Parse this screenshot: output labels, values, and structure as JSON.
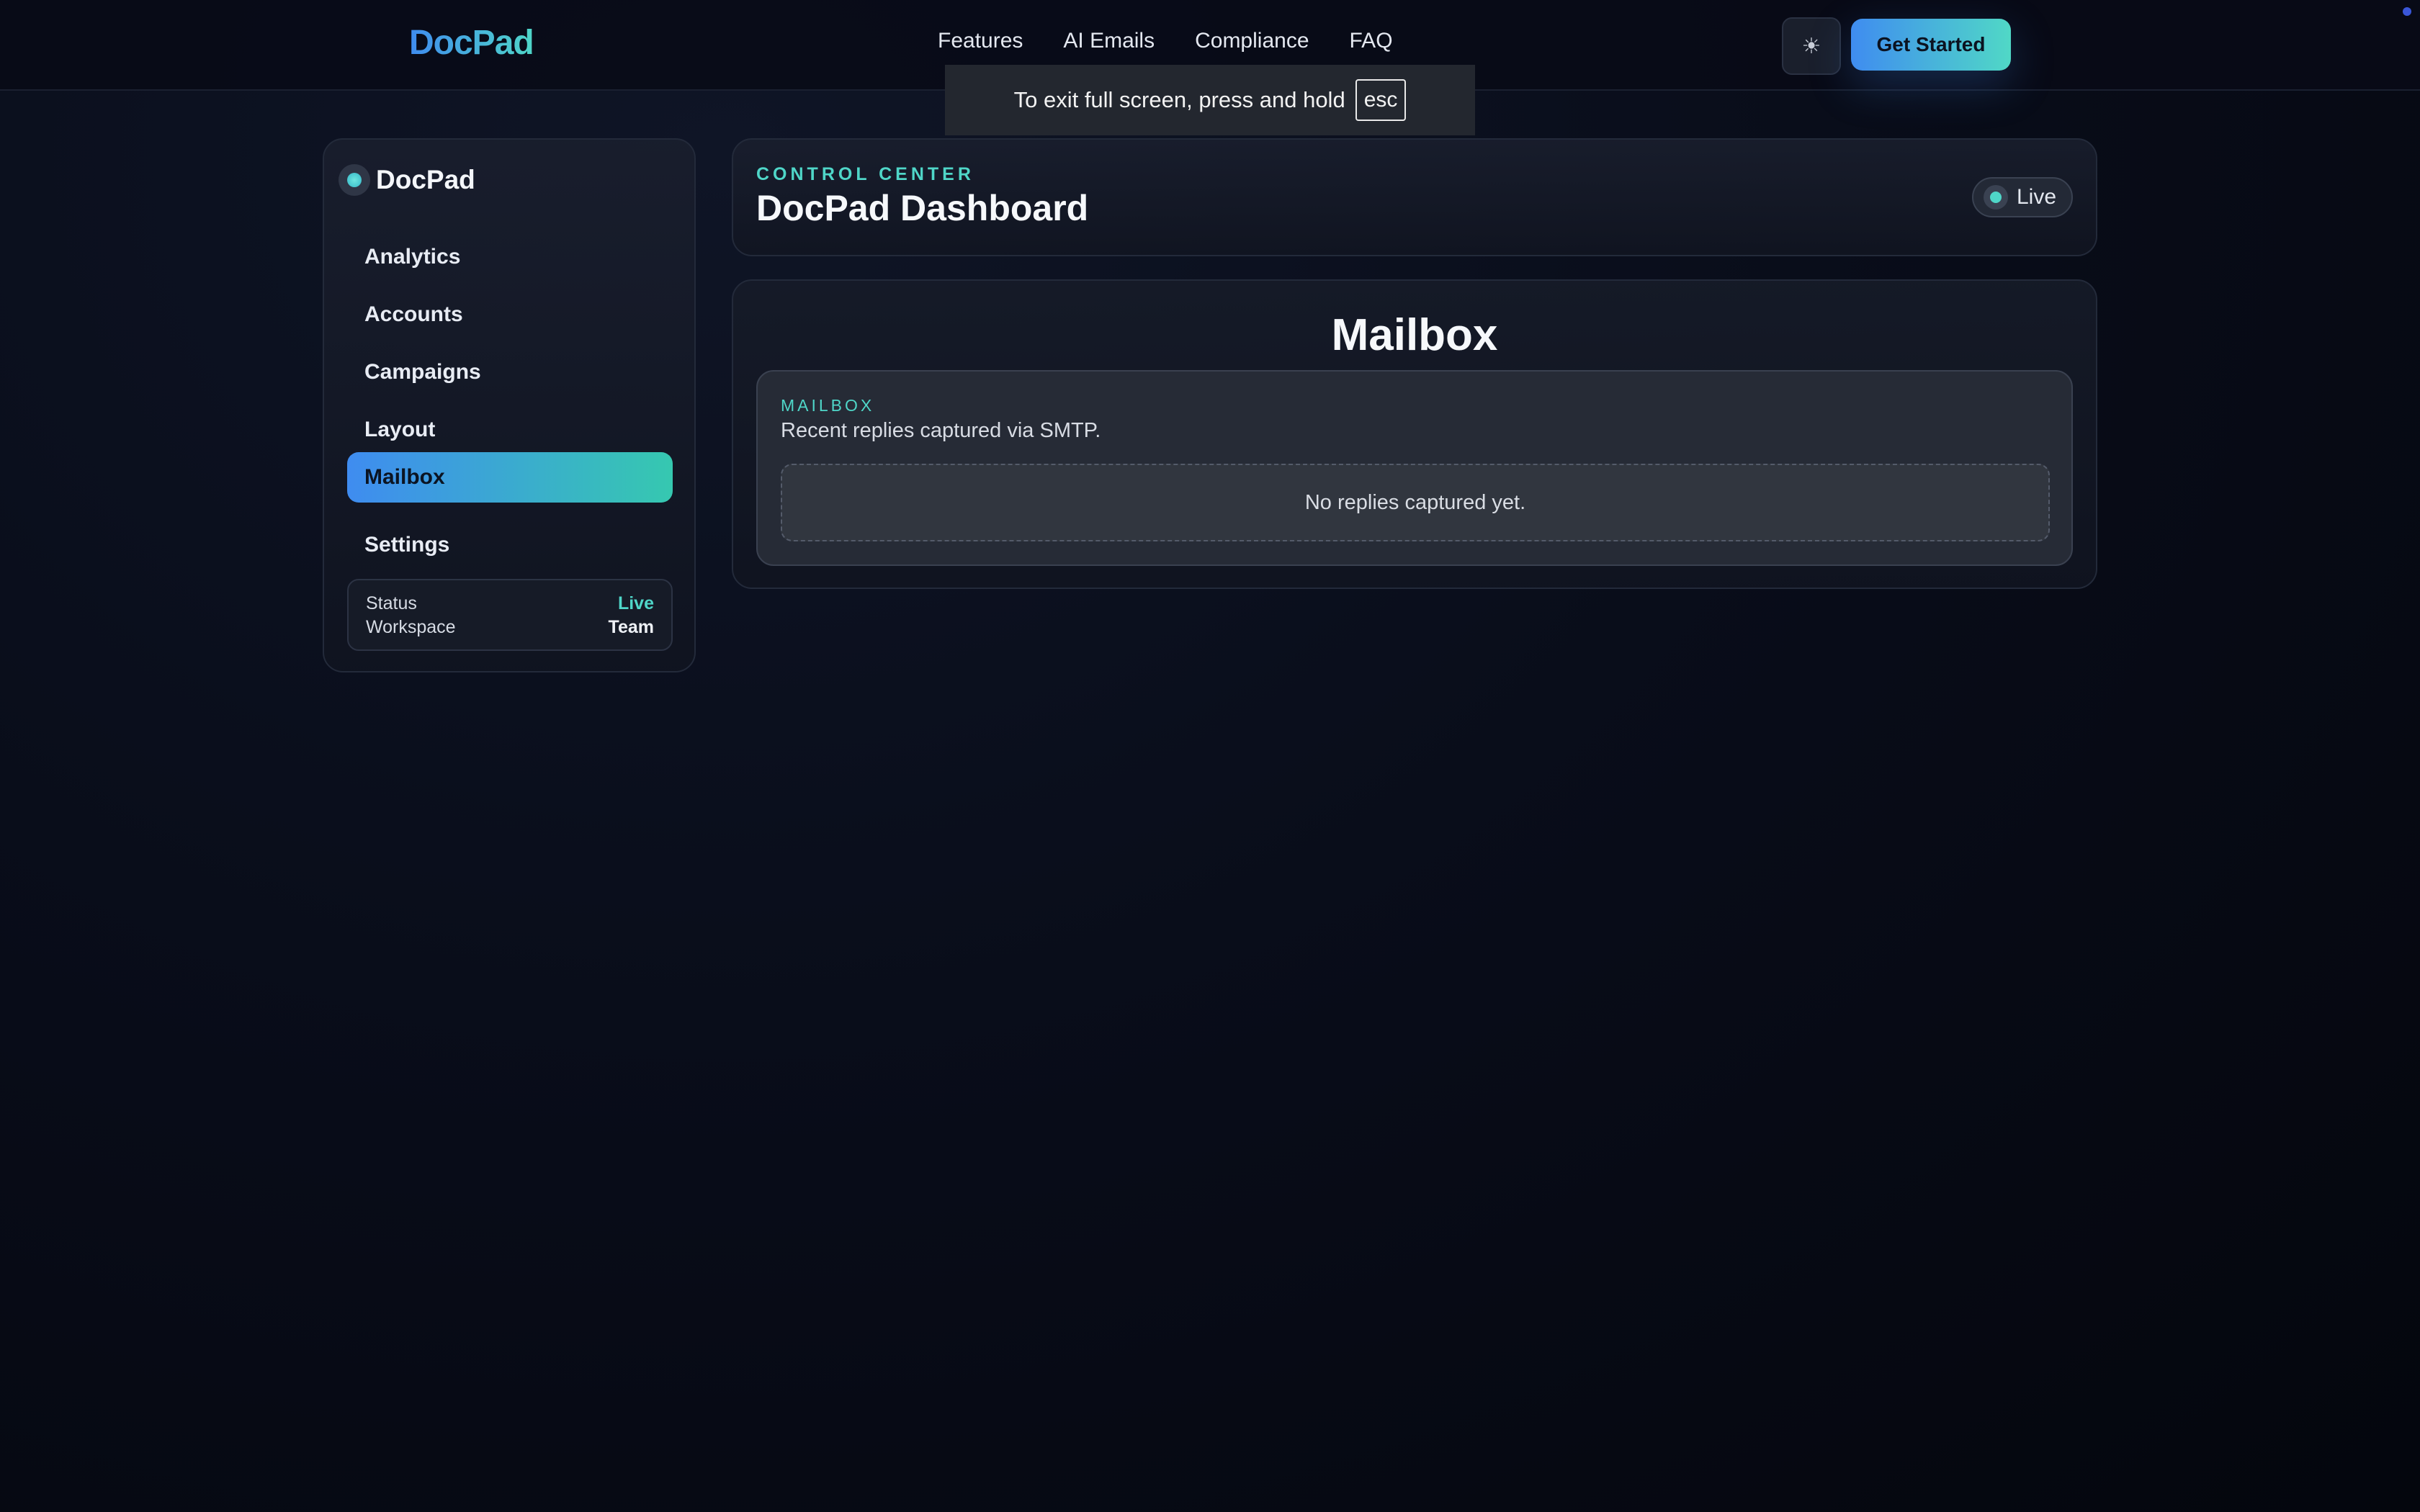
{
  "topnav": {
    "brand": "DocPad",
    "links": [
      "Features",
      "AI Emails",
      "Compliance",
      "FAQ"
    ],
    "theme_icon": "sun-icon",
    "cta_label": "Get Started"
  },
  "fullscreen_toast": {
    "message": "To exit full screen, press and hold",
    "key": "esc"
  },
  "sidebar": {
    "brand": "DocPad",
    "items": [
      {
        "label": "Analytics"
      },
      {
        "label": "Accounts"
      },
      {
        "label": "Campaigns"
      },
      {
        "label": "Layout"
      },
      {
        "label": "Mailbox",
        "active": true
      },
      {
        "label": "Settings"
      }
    ],
    "status": {
      "status_label": "Status",
      "status_value": "Live",
      "workspace_label": "Workspace",
      "workspace_value": "Team"
    }
  },
  "header": {
    "eyebrow": "CONTROL CENTER",
    "title": "DocPad Dashboard",
    "live_badge": "Live"
  },
  "mailbox": {
    "title": "Mailbox",
    "eyebrow": "MAILBOX",
    "description": "Recent replies captured via SMTP.",
    "empty_state": "No replies captured yet."
  },
  "colors": {
    "accent_blue": "#3f8cf0",
    "accent_teal": "#4fd6c8",
    "background": "#090d1a"
  }
}
